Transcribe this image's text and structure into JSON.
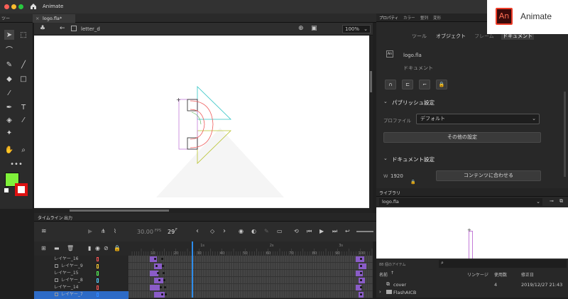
{
  "titlebar": {
    "app_title": "Animate"
  },
  "tabs": [
    {
      "label": "logo.fla*"
    }
  ],
  "toolbar_label": "ツー",
  "editbar": {
    "scene": "letter_d",
    "zoom": "100%"
  },
  "timeline": {
    "title": "タイムライン",
    "output": "出力",
    "fps": "30.00",
    "fps_unit": "FPS",
    "frame": "29",
    "frame_unit": "F",
    "ruler": [
      "10",
      "20",
      "30",
      "40",
      "50",
      "60",
      "70",
      "80",
      "90",
      "100"
    ],
    "ruler_sec": [
      "1s",
      "2s",
      "3s"
    ],
    "layers": [
      {
        "name": "レイヤー_16",
        "color": "#ff5555",
        "indent": false
      },
      {
        "name": "レイヤー_9",
        "color": "#ffcc33",
        "indent": true
      },
      {
        "name": "レイヤー_15",
        "color": "#55ff55",
        "indent": false
      },
      {
        "name": "レイヤー_8",
        "color": "#55ccff",
        "indent": true
      },
      {
        "name": "レイヤー_14",
        "color": "#ff5555",
        "indent": false
      },
      {
        "name": "レイヤー_7",
        "color": "#3388ff",
        "indent": true
      }
    ]
  },
  "props": {
    "tabs": [
      "プロパティ",
      "カラー",
      "整列",
      "変形"
    ],
    "subtabs": [
      "ツール",
      "オブジェクト",
      "フレーム",
      "ドキュメント"
    ],
    "file": "logo.fla",
    "doc_label": "ドキュメント",
    "publish": "パブリッシュ設定",
    "profile_label": "プロファイル",
    "profile_value": "デフォルト",
    "other_settings": "その他の設定",
    "doc_settings": "ドキュメント設定",
    "w_label": "W",
    "w_value": "1920",
    "fit_button": "コンテンツに合わせる"
  },
  "library": {
    "title": "ライブラリ",
    "file": "logo.fla",
    "count": "88 個のアイテム",
    "columns": [
      "名前",
      "リンケージ",
      "使用数",
      "修正日"
    ],
    "items": [
      {
        "name": "cover",
        "usage": "4",
        "date": "2019/12/27 21:43"
      },
      {
        "name": "FlashAICB",
        "usage": "",
        "date": ""
      }
    ]
  },
  "badge": {
    "label": "Animate",
    "logo": "An"
  },
  "colors": {
    "accent": "#2d8ceb",
    "stroke": "#222222",
    "fill": "#7ff03a"
  }
}
